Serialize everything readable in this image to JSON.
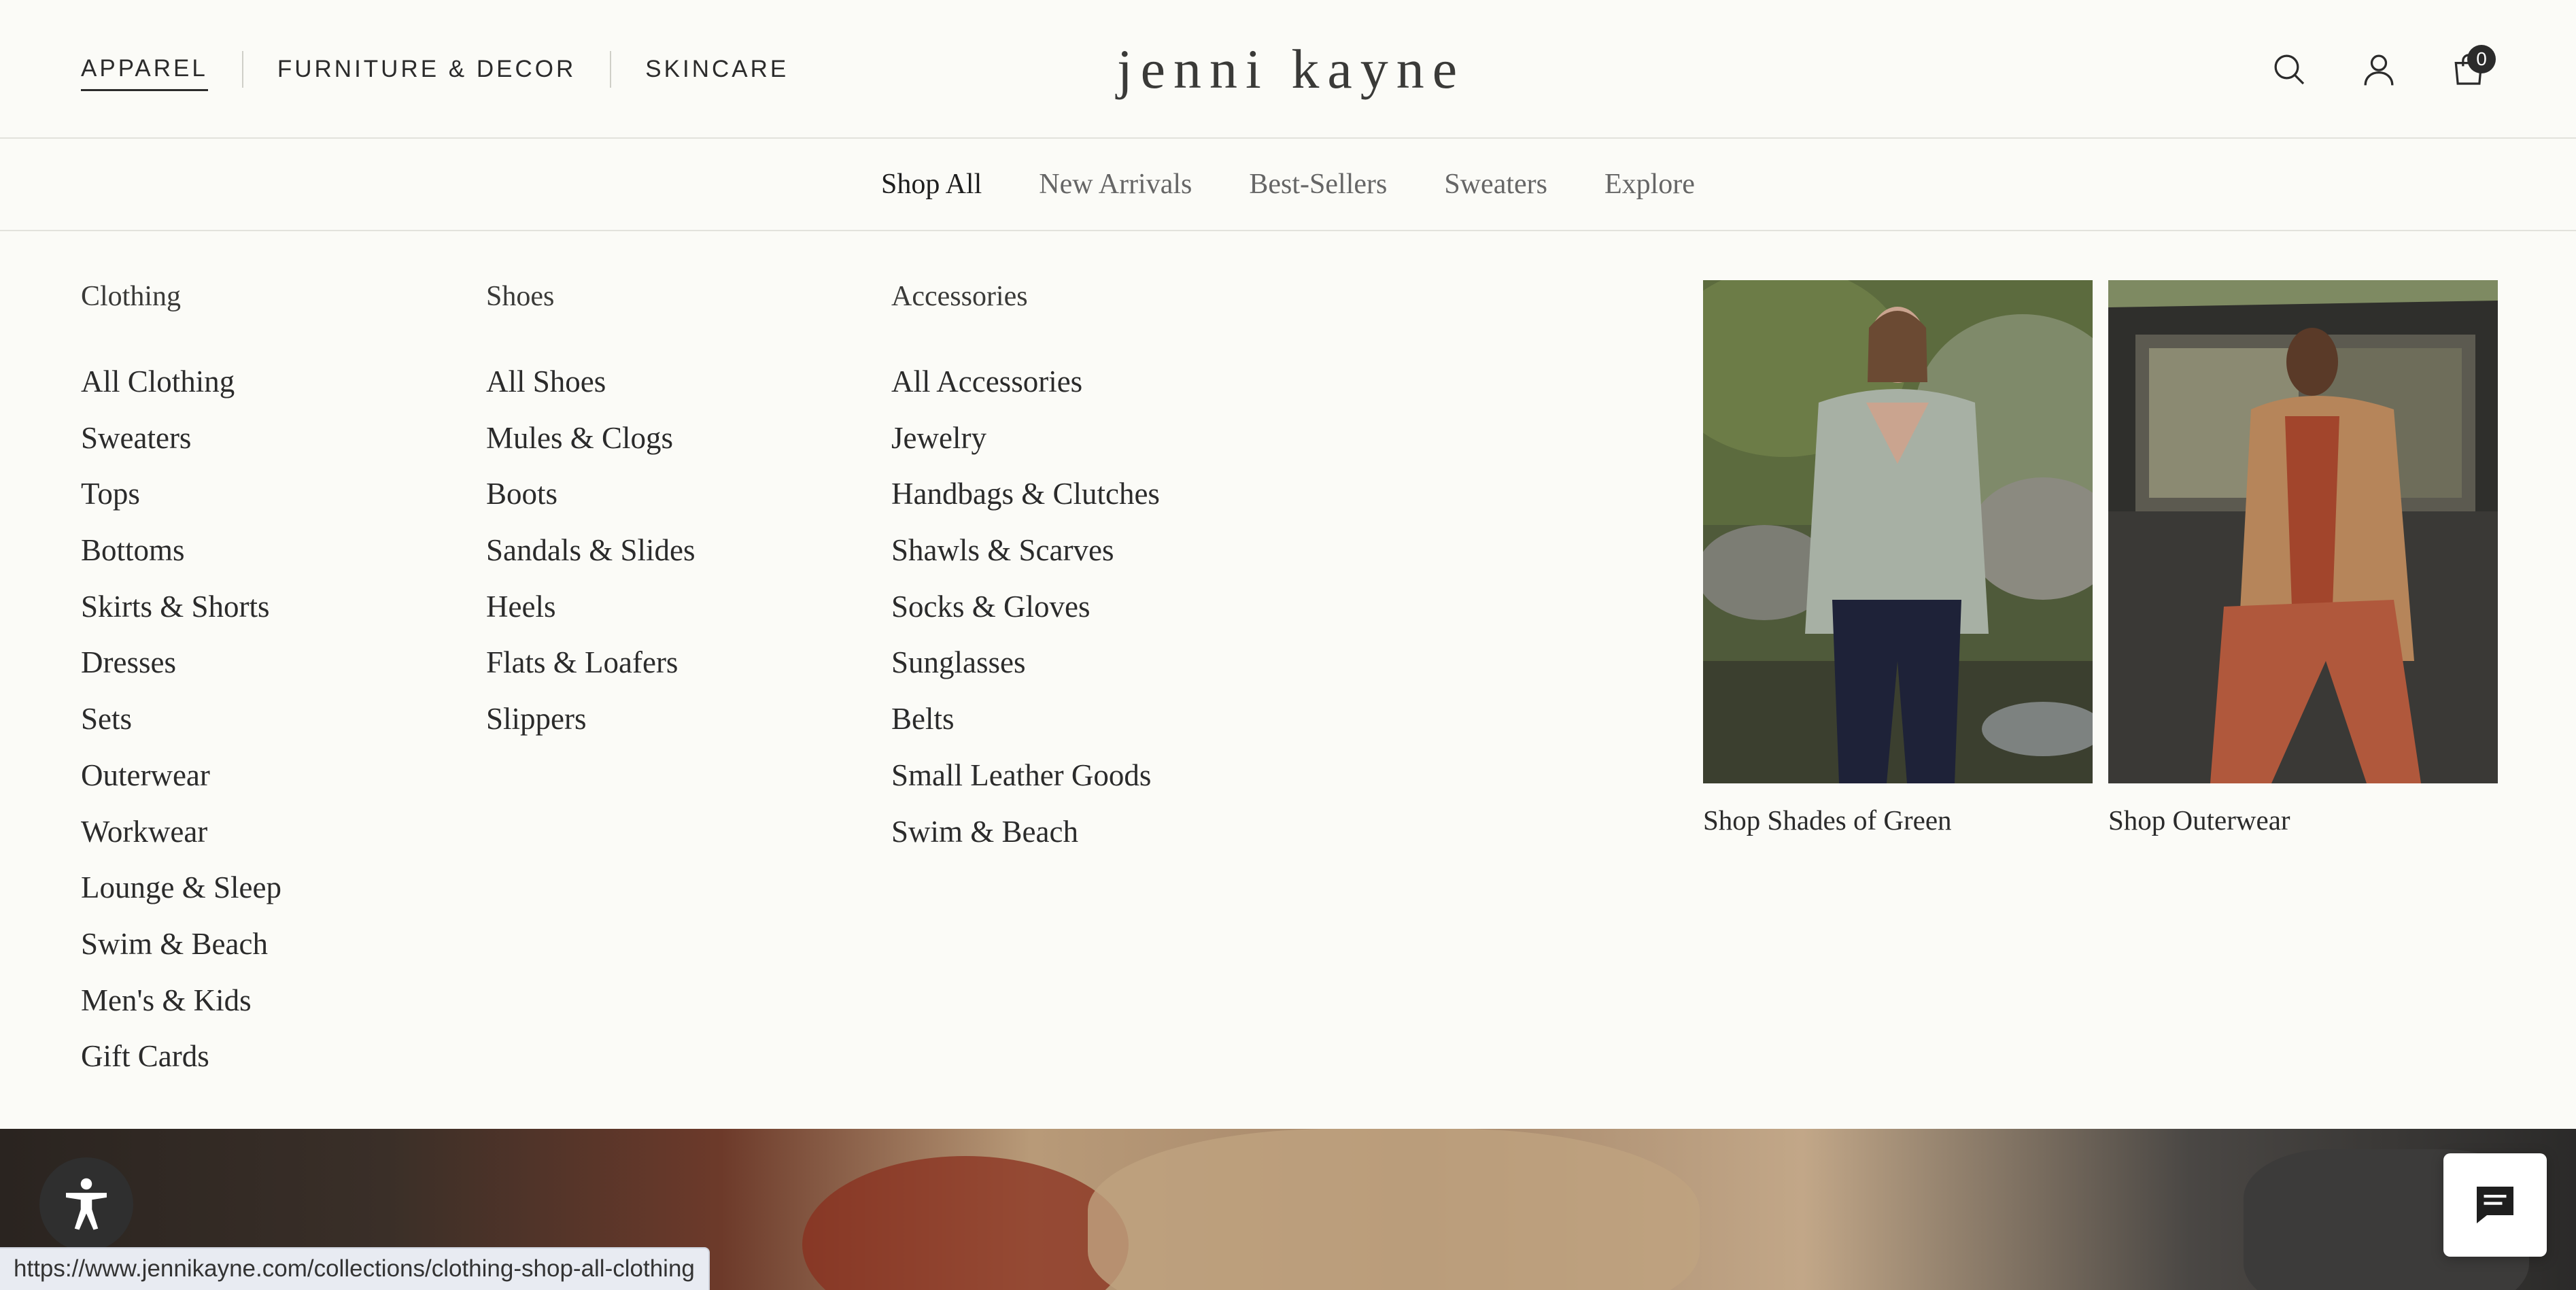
{
  "header": {
    "categories": [
      "APPAREL",
      "FURNITURE & DECOR",
      "SKINCARE"
    ],
    "active_category": "APPAREL",
    "logo": "jenni kayne",
    "icons": [
      "search-icon",
      "account-icon",
      "cart-icon"
    ],
    "cart_count": "0"
  },
  "subnav": {
    "items": [
      "Shop All",
      "New Arrivals",
      "Best-Sellers",
      "Sweaters",
      "Explore"
    ],
    "active": "Shop All"
  },
  "menu": {
    "clothing": {
      "title": "Clothing",
      "items": [
        "All Clothing",
        "Sweaters",
        "Tops",
        "Bottoms",
        "Skirts & Shorts",
        "Dresses",
        "Sets",
        "Outerwear",
        "Workwear",
        "Lounge & Sleep",
        "Swim & Beach",
        "Men's & Kids",
        "Gift Cards"
      ]
    },
    "shoes": {
      "title": "Shoes",
      "items": [
        "All Shoes",
        "Mules & Clogs",
        "Boots",
        "Sandals & Slides",
        "Heels",
        "Flats & Loafers",
        "Slippers"
      ]
    },
    "accessories": {
      "title": "Accessories",
      "items": [
        "All Accessories",
        "Jewelry",
        "Handbags & Clutches",
        "Shawls & Scarves",
        "Socks & Gloves",
        "Sunglasses",
        "Belts",
        "Small Leather Goods",
        "Swim & Beach"
      ]
    },
    "promos": [
      {
        "caption": "Shop Shades of Green"
      },
      {
        "caption": "Shop Outerwear"
      }
    ]
  },
  "status_bar": {
    "url": "https://www.jennikayne.com/collections/clothing-shop-all-clothing"
  },
  "colors": {
    "background": "#fbfbf7",
    "text": "#2b2b2b",
    "muted": "#666666",
    "divider": "#e2e2dc"
  }
}
